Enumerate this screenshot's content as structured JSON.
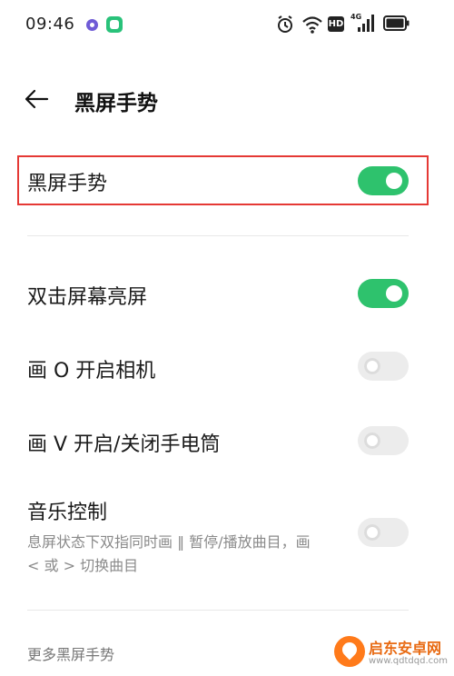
{
  "status_bar": {
    "time": "09:46",
    "network_label": "4G",
    "hd_label": "HD"
  },
  "header": {
    "title": "黑屏手势"
  },
  "settings": [
    {
      "label": "黑屏手势",
      "enabled": true
    },
    {
      "label": "双击屏幕亮屏",
      "enabled": true
    },
    {
      "label": "画 O 开启相机",
      "enabled": false
    },
    {
      "label": "画 V 开启/关闭手电筒",
      "enabled": false
    },
    {
      "label": "音乐控制",
      "enabled": false,
      "description": "息屏状态下双指同时画 ‖ 暂停/播放曲目，画 < 或 > 切换曲目"
    }
  ],
  "footer": {
    "section_title": "更多黑屏手势"
  },
  "watermark": {
    "name": "启东安卓网",
    "url": "www.qdtdqd.com"
  },
  "colors": {
    "switch_on": "#2ec26d",
    "switch_off": "#ececec",
    "highlight": "#e53935"
  }
}
